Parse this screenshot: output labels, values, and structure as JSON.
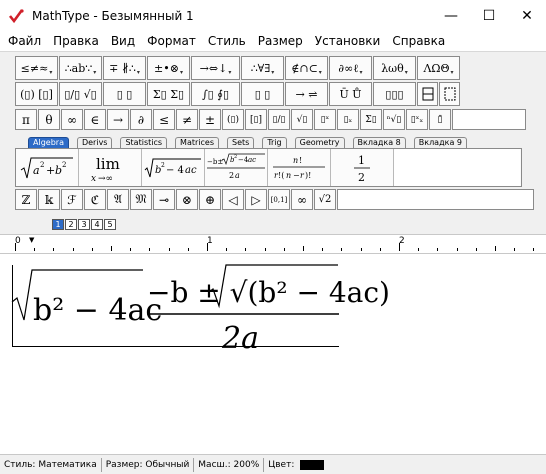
{
  "window": {
    "title": "MathType - Безымянный 1",
    "minimize_glyph": "—",
    "maximize_glyph": "☐",
    "close_glyph": "✕"
  },
  "menu": [
    "Файл",
    "Правка",
    "Вид",
    "Формат",
    "Стиль",
    "Размер",
    "Установки",
    "Справка"
  ],
  "palette_row1": [
    "≤≠≈",
    "∴ab∵",
    "∓ ∦∴",
    "±•⊗",
    "→⇔↓",
    "∴∀∃",
    "∉∩⊂",
    "∂∞ℓ",
    "λωθ",
    "ΛΩΘ"
  ],
  "palette_row2": [
    "(▯) [▯]",
    "▯/▯ √▯",
    "▯ ▯",
    "Σ▯ Σ▯",
    "∫▯ ∮▯",
    "▯ ▯",
    "→ ⇌",
    "Ū Ů",
    "▯▯▯"
  ],
  "icons": {
    "palette_row1": [
      "inequality-palette-icon",
      "spaces-palette-icon",
      "embellishments-palette-icon",
      "operators-palette-icon",
      "arrows-palette-icon",
      "logic-palette-icon",
      "set-theory-palette-icon",
      "misc-symbols-palette-icon",
      "greek-lowercase-palette-icon",
      "greek-uppercase-palette-icon"
    ],
    "palette_row2": [
      "fences-palette-icon",
      "fractions-radicals-palette-icon",
      "scripts-palette-icon",
      "summation-palette-icon",
      "integrals-palette-icon",
      "underbar-overbar-palette-icon",
      "labeled-arrows-palette-icon",
      "products-palette-icon",
      "matrices-palette-icon",
      "box-palette-icon",
      "spacing-palette-icon"
    ],
    "quick_row": [
      "pi-icon",
      "theta-icon",
      "infinity-icon",
      "element-of-icon",
      "right-arrow-icon",
      "partial-icon",
      "less-equal-icon",
      "not-equal-icon",
      "plus-minus-icon",
      "parentheses-icon",
      "brackets-icon",
      "fraction-icon",
      "sqrt-icon",
      "superscript-icon",
      "subscript-icon",
      "sum-icon",
      "nth-root-icon",
      "sup-sub-icon",
      "bar-icon"
    ],
    "sym_row": [
      "blackboard-z-icon",
      "blackboard-k-icon",
      "script-f-icon",
      "fraktur-c-icon",
      "fraktur-a-icon",
      "fraktur-m-icon",
      "multimap-icon",
      "circle-times-icon",
      "circle-plus-icon",
      "left-triangle-icon",
      "right-triangle-icon",
      "interval-icon",
      "infinity-icon-2",
      "sqrt2-icon"
    ]
  },
  "quick_row": [
    "π",
    "θ",
    "∞",
    "∈",
    "→",
    "∂",
    "≤",
    "≠",
    "±",
    "(▯)",
    "[▯]",
    "▯/▯",
    "√▯",
    "▯ˣ",
    "▯ₓ",
    "Σ▯",
    "ⁿ√▯",
    "▯ˣₓ",
    "▯̄"
  ],
  "tabs": [
    "Algebra",
    "Derivs",
    "Statistics",
    "Matrices",
    "Sets",
    "Trig",
    "Geometry",
    "Вкладка 8",
    "Вкладка 9"
  ],
  "sym_row": [
    "ℤ",
    "𝕜",
    "ℱ",
    "ℭ",
    "𝔄",
    "𝔐",
    "⊸",
    "⊗",
    "⊕",
    "◁",
    "▷",
    "[0,1]",
    "∞",
    "√2"
  ],
  "size_buttons": [
    "1",
    "2",
    "3",
    "4",
    "5"
  ],
  "ruler": {
    "labels": [
      "0",
      "1",
      "2"
    ],
    "marker_glyph": "▼"
  },
  "equation": {
    "radicand_left": "b² − 4ac",
    "numerator": "−b ± √(b² − 4ac)",
    "denominator": "2a"
  },
  "status": {
    "style": "Стиль: Математика",
    "size": "Размер: Обычный",
    "zoom": "Масш.: 200%",
    "color": "Цвет:",
    "color_value": "#000000"
  }
}
